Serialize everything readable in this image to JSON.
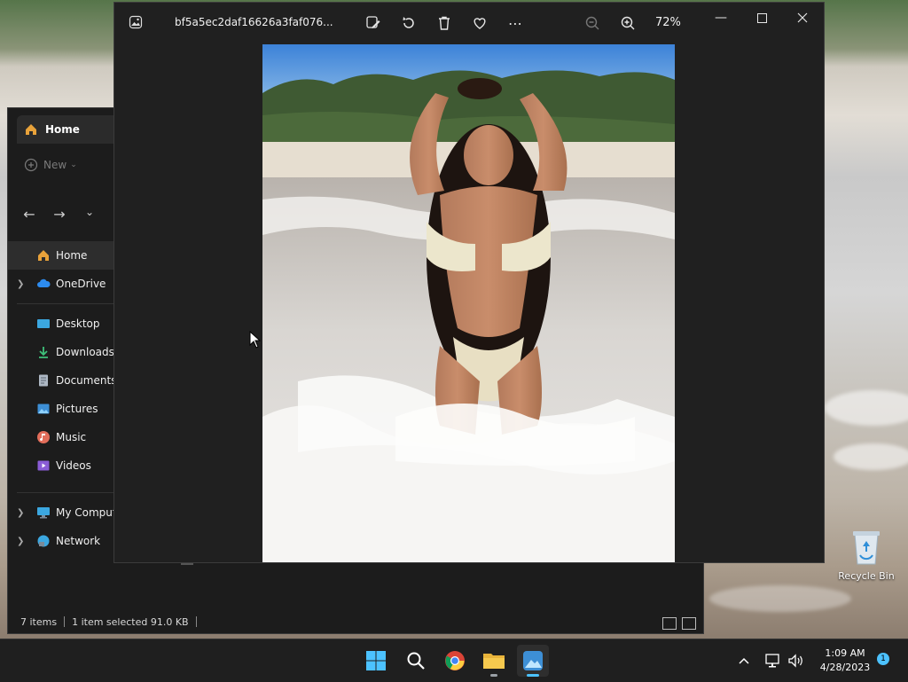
{
  "explorer": {
    "tab_label": "Home",
    "new_label": "New",
    "nav_items": [
      {
        "label": "Home"
      },
      {
        "label": "OneDrive"
      },
      {
        "label": "Desktop"
      },
      {
        "label": "Downloads"
      },
      {
        "label": "Documents"
      },
      {
        "label": "Pictures"
      },
      {
        "label": "Music"
      },
      {
        "label": "Videos"
      },
      {
        "label": "My Comput"
      },
      {
        "label": "Network"
      }
    ],
    "status": {
      "items": "7 items",
      "selected": "1 item selected  91.0 KB"
    }
  },
  "viewer": {
    "filename": "bf5a5ec2daf16626a3faf076...",
    "zoom_level": "72%"
  },
  "desktop": {
    "recycle_bin_label": "Recycle Bin"
  },
  "taskbar": {
    "time": "1:09 AM",
    "date": "4/28/2023",
    "notification_count": "1"
  },
  "icons": {
    "app": "photos-icon",
    "edit": "edit-image-icon",
    "rotate": "rotate-icon",
    "delete": "trash-icon",
    "favorite": "heart-icon",
    "more": "more-icon",
    "zoom_out": "zoom-out-icon",
    "zoom_in": "zoom-in-icon"
  },
  "colors": {
    "accent": "#4cc2ff",
    "folder_home": "#e8a23a",
    "onedrive": "#2d8cf0"
  }
}
